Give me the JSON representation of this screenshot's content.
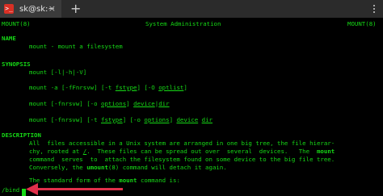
{
  "colors": {
    "terminal_bg": "#000000",
    "terminal_fg": "#16d916",
    "titlebar_bg": "#2b2b2b",
    "tab_bg": "#3b3b3b",
    "tab_icon": "#d93025",
    "arrow": "#e0304a"
  },
  "tab": {
    "icon": "terminal-icon",
    "icon_glyph": ">_",
    "label": "sk@sk:~",
    "close_glyph": "×"
  },
  "new_tab": {
    "icon": "plus-icon",
    "glyph": "+"
  },
  "menu": {
    "icon": "kebab-menu-icon"
  },
  "man": {
    "header_left": "MOUNT(8)",
    "header_center": "System Administration",
    "header_right": "MOUNT(8)",
    "name_heading": "NAME",
    "name_text": "mount - mount a filesystem",
    "synopsis_heading": "SYNOPSIS",
    "syn1": "mount [-l|-h|-V]",
    "syn2a": "mount -a [-fFnrsvw] [-t ",
    "syn2b": "fstype",
    "syn2c": "] [-O ",
    "syn2d": "optlist",
    "syn2e": "]",
    "syn3a": "mount [-fnrsvw] [-o ",
    "syn3b": "options",
    "syn3c": "] ",
    "syn3d": "device",
    "syn3e": "|",
    "syn3f": "dir",
    "syn4a": "mount [-fnrsvw] [-t ",
    "syn4b": "fstype",
    "syn4c": "] [-o ",
    "syn4d": "options",
    "syn4e": "] ",
    "syn4f": "device",
    "syn4g": " ",
    "syn4h": "dir",
    "description_heading": "DESCRIPTION",
    "desc1": "All  files accessible in a Unix system are arranged in one big tree, the file hierar-",
    "desc2a": "chy, rooted at ",
    "desc2b": "/",
    "desc2c": ".  These files can be spread out over  several  devices.   The  ",
    "desc2d": "mount",
    "desc3": "command  serves  to  attach the filesystem found on some device to the big file tree.",
    "desc4a": "Conversely, the ",
    "desc4b": "umount",
    "desc4c": "(8) command will detach it again.",
    "desc5a": "The standard form of the ",
    "desc5b": "mount",
    "desc5c": " command is:"
  },
  "prompt": {
    "text": "/bind"
  }
}
